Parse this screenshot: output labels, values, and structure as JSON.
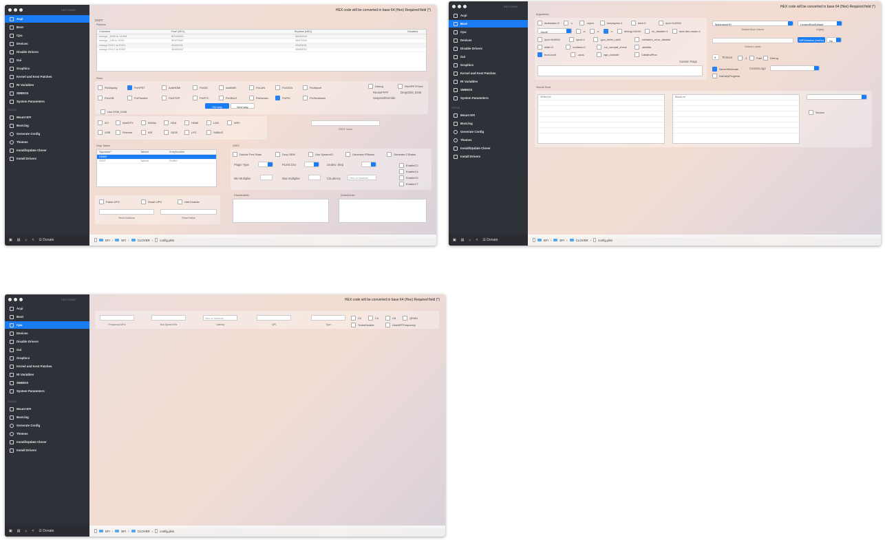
{
  "app": {
    "sections_header": "SECTIONS",
    "tools_header": "TOOLS",
    "hex_note": "HEX code will be converted in base 64 (Hex)   Required field (*)",
    "nav": [
      "Acpi",
      "Boot",
      "Cpu",
      "Devices",
      "Disable Drivers",
      "Gui",
      "Graphics",
      "Kernel and Kext Patches",
      "Rt Variables",
      "SMBIOS",
      "System Parameters"
    ],
    "tools": [
      "Mount EFI",
      "Boot.log",
      "Generate Config",
      "Themes",
      "Install/Update Clover",
      "Install Drivers"
    ],
    "donate": "Donate",
    "path": [
      "EFI",
      "EFI",
      "CLOVER",
      "config.plist"
    ],
    "colors": {
      "sidebar": "#2f3138",
      "accent": "#1a7cf5"
    },
    "icons": [
      "folder-icon",
      "document-icon",
      "home-icon",
      "share-icon",
      "donate-icon",
      "gear-icon"
    ]
  },
  "acpi": {
    "dsdt_label": "DSDT",
    "patches_label": "Patches",
    "patch_cols": [
      "Comment",
      "Find* [HEX]",
      "Replace [HEX]",
      "Disabled"
    ],
    "patch_rows": [
      [
        "change _DSM to XDSM",
        "5F44534D",
        "58445344"
      ],
      [
        "change _OSI to XOSI",
        "5F4F5349",
        "584F5349"
      ],
      [
        "change EHC1 to EH01",
        "45484331",
        "45483031"
      ],
      [
        "change EHC2 to EH02",
        "45484332",
        "45483032"
      ]
    ],
    "fixes_label": "Fixes",
    "fixes_row1": [
      "FixDisplay",
      "FixHPET",
      "AddHDMI",
      "FixIDE",
      "AddIMEI",
      "FixLAN",
      "FixSATA",
      "FixAirport"
    ],
    "fixes_row2": [
      "FixUSB",
      "FixFirewire",
      "FixDTGP",
      "FixRTC",
      "FixSBUS",
      "FixDarwin",
      "FixPIC",
      "FixShutdown"
    ],
    "fix_extra": [
      "Debug",
      "ReuseFFFF",
      "SuspendOverride",
      "RtcHPETFixed",
      "DropOEM_DSM"
    ],
    "old_way": "Old way",
    "new_way": "New way",
    "use_dsm": "Use DSM_DSM",
    "dev_row1": [
      "ATI",
      "IntelGFX",
      "NVidia",
      "HDA",
      "HDMI",
      "LAN",
      "WIFI"
    ],
    "dev_row2": [
      "USB",
      "Firewire",
      "IDE",
      "SATA",
      "LPC",
      "SMBUS"
    ],
    "dsdt_name_label": "DSDT name",
    "drop_tables_label": "Drop Tables",
    "drop_cols": [
      "Signature*",
      "TableId",
      "EntryNumber"
    ],
    "drop_rows": [
      [
        "DMAR",
        "",
        ""
      ],
      [
        "SSDT",
        "Tableid",
        "PmRef"
      ]
    ],
    "ssdt_label": "SSDT",
    "ssdt_checks": [
      "Double First State",
      "Drop OEM",
      "Use SystemIO",
      "Generate PStates",
      "Generate CStates"
    ],
    "cstates": [
      "EnableC2",
      "EnableC4",
      "EnableC6",
      "EnableC7"
    ],
    "plugin_type": "Plugin Type",
    "plimit": "PLimit Dict",
    "underv": "Underv. Step",
    "min_mult": "Min Multiplier",
    "max_mult": "Max Multiplier",
    "c3lat": "C3Latency",
    "c3lat_ph": "Hex or Number",
    "bottom_checks": [
      "Patch APIC",
      "Smart UPS",
      "Halt Enabler"
    ],
    "reset_address": "Reset Address",
    "reset_value": "Reset Value",
    "disabled_aml": "DisabledAML",
    "sorted_order": "SortedOrder"
  },
  "boot": {
    "arguments_label": "Arguments",
    "args_row1": [
      "darkwake=0",
      "-v",
      "-xcpm",
      "keepsyms=1",
      "dart=0",
      "npci=0x2000"
    ],
    "args_row2": [
      "-s",
      "-x",
      "-v",
      "debug=0x100",
      "nv_disable=1",
      "kext-dev-mode=1"
    ],
    "args_row3": [
      "npci=0x3000",
      "cpus=1",
      "-gux_defer_usb2",
      "-nehalem_error_disable"
    ],
    "args_row4": [
      "slide=0",
      "rootless=0",
      "-no_compat_check",
      "-alcbeta"
    ],
    "args_row5": [
      "boot-uuid",
      "-cpus",
      "vga_console",
      "CatalinaPlus"
    ],
    "args_select": "-liluoff",
    "default_volume": "MacintoshHD",
    "default_volume_label": "Default Boot Volume",
    "legacy": "LegacyBiosDefault",
    "legacy_label": "Legacy",
    "default_loader": "Default Loader",
    "timeout": "5",
    "timeout_label": "Timeout",
    "timeout_checks": [
      "-1",
      "Fast",
      "Debug"
    ],
    "xmp_btn": "XMPDetection (Yes/No)",
    "xmp_val": "No",
    "never_hibernate": "NeverHibernate",
    "custom_logo": "CustomLogo",
    "notanymore": "NoEarlyProgress",
    "custom_flags": "Custom Flags",
    "secure_boot": "Secure Boot",
    "whitelist": "WhiteList",
    "blacklist": "BlackList",
    "secure": "Secure"
  },
  "cpu": {
    "fields": [
      "Frequency MHz",
      "Bus Speed kHz",
      "Latency",
      "QPI",
      "Type"
    ],
    "latency_ph": "Hex or Number",
    "checks": [
      "C2",
      "C4",
      "C6",
      "QEMU",
      "TurboDisable",
      "UseARTFrequency"
    ]
  }
}
